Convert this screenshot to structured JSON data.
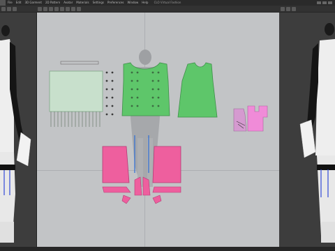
{
  "app": {
    "window_title": "CLO Virtual Fashion",
    "menu": [
      "File",
      "Edit",
      "3D Garment",
      "2D Pattern",
      "Avatar",
      "Materials",
      "Settings",
      "Preferences",
      "Window",
      "Help"
    ]
  },
  "colors": {
    "menubar": "#2a2a2a",
    "toolbar": "#323232",
    "pattern_bg": "#c2c4c6",
    "avatar_bg": "#3d3d3d",
    "garment_green": "#5ec66a",
    "pattern_pink": "#ee5f9e",
    "ruffle_mint": "#c8e0cc",
    "avatar_white": "#eeeeee",
    "avatar_black": "#151515",
    "pad_lavender": "#d59ad0"
  },
  "icons": [
    "3d-select-icon",
    "rotate-icon",
    "zoom-icon",
    "pattern-edit-icon",
    "segment-icon",
    "sewing-icon",
    "avatar-icon"
  ]
}
